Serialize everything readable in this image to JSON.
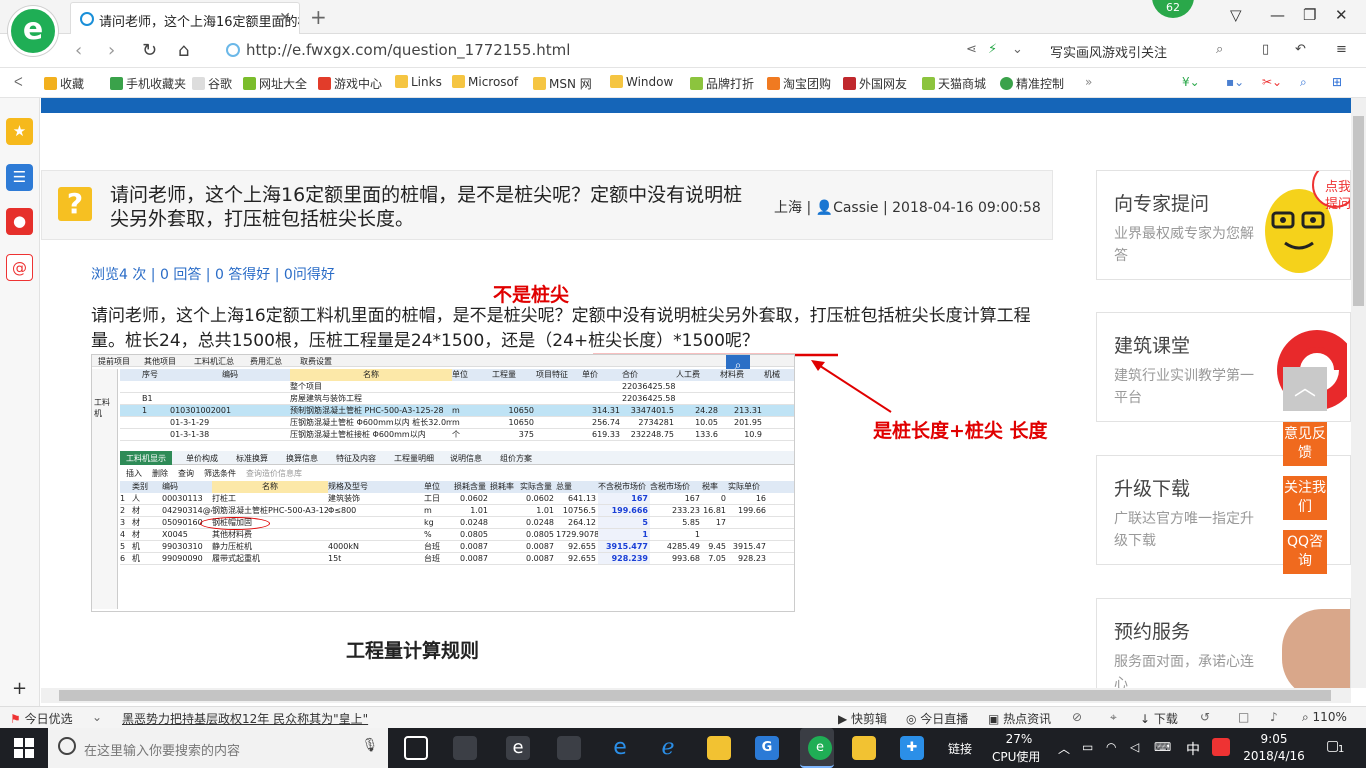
{
  "tab": {
    "title": "请问老师，这个上海16定额里面的桩"
  },
  "badge": "62",
  "address": {
    "url": "http://e.fwxgx.com/question_1772155.html",
    "search_hint": "写实画风游戏引关注"
  },
  "bookmarks": [
    "收藏",
    "手机收藏夹",
    "谷歌",
    "网址大全",
    "游戏中心",
    "Links",
    "Microsof",
    "MSN 网",
    "Window",
    "品牌打折",
    "淘宝团购",
    "外国网友",
    "天猫商城",
    "精准控制"
  ],
  "question": {
    "title": "请问老师，这个上海16定额里面的桩帽，是不是桩尖呢？定额中没有说明桩尖另外套取，打压桩包括桩尖长度。",
    "location": "上海",
    "author": "Cassie",
    "datetime": "2018-04-16 09:00:58",
    "stats": "浏览4 次 | 0 回答 | 0 答得好 | 0问得好",
    "body_text": "请问老师，这个上海16定额工料机里面的桩帽，是不是桩尖呢？定额中没有说明桩尖另外套取，打压桩包括桩尖长度计算工程量。桩长24，总共1500根，压桩工程量是24*1500，还是（24+桩尖长度）*1500呢？",
    "annotation_top": "不是桩尖",
    "annotation_right": "是桩长度+桩尖 长度",
    "section_heading": "工程量计算规则"
  },
  "screenshot": {
    "menu": [
      "提前项目",
      "其他项目",
      "工料机汇总",
      "费用汇总",
      "取费设置"
    ],
    "upper_headers": [
      "序号",
      "编码",
      "名称",
      "单位",
      "工程量",
      "项目特征",
      "单价",
      "合价",
      "人工费",
      "材料费",
      "机械"
    ],
    "upper_rows": [
      [
        "",
        "",
        "整个项目",
        "",
        "",
        "",
        "",
        "22036425.58",
        "",
        "",
        ""
      ],
      [
        "B1",
        "",
        "房屋建筑与装饰工程",
        "",
        "",
        "",
        "",
        "22036425.58",
        "",
        "",
        ""
      ],
      [
        "1",
        "010301002001",
        "预制钢筋混凝土管桩 PHC-500-A3-125-28",
        "m",
        "10650",
        "",
        "314.31",
        "3347401.5",
        "24.28",
        "213.31",
        ""
      ],
      [
        "",
        "01-3-1-29",
        "压钢筋混凝土管桩 Φ600mm以内 桩长32.0m以内",
        "m",
        "10650",
        "",
        "256.74",
        "2734281",
        "10.05",
        "201.95",
        ""
      ],
      [
        "",
        "01-3-1-38",
        "压钢筋混凝土管桩接桩 Φ600mm以内",
        "个",
        "375",
        "",
        "619.33",
        "232248.75",
        "133.6",
        "10.9",
        ""
      ]
    ],
    "tabs": [
      "工料机显示",
      "单价构成",
      "标准换算",
      "换算信息",
      "特征及内容",
      "工程量明细",
      "说明信息",
      "组价方案"
    ],
    "toolbar": [
      "插入",
      "删除",
      "查询",
      "筛选条件",
      "查询造价信息库"
    ],
    "lower_headers": [
      "",
      "类别",
      "编码",
      "名称",
      "规格及型号",
      "单位",
      "损耗含量",
      "损耗率",
      "实际含量",
      "总量",
      "不含税市场价",
      "含税市场价",
      "税率",
      "实际单价"
    ],
    "lower_rows": [
      [
        "1",
        "人",
        "00030113",
        "打桩工",
        "建筑装饰",
        "工日",
        "0.0602",
        "",
        "0.0602",
        "641.13",
        "167",
        "167",
        "0",
        "16"
      ],
      [
        "2",
        "材",
        "04290314@4",
        "钢筋混凝土管桩PHC-500-A3-125...",
        "Φ≤800",
        "m",
        "1.01",
        "",
        "1.01",
        "10756.5",
        "199.666",
        "233.23",
        "16.81",
        "199.66"
      ],
      [
        "3",
        "材",
        "05090160",
        "钢桩帽加固",
        "",
        "kg",
        "0.0248",
        "",
        "0.0248",
        "264.12",
        "5",
        "5.85",
        "17",
        ""
      ],
      [
        "4",
        "材",
        "X0045",
        "其他材料费",
        "",
        "%",
        "0.0805",
        "",
        "0.0805",
        "1729.9078",
        "1",
        "1",
        "",
        ""
      ],
      [
        "5",
        "机",
        "99030310",
        "静力压桩机",
        "4000kN",
        "台班",
        "0.0087",
        "",
        "0.0087",
        "92.655",
        "3915.477",
        "4285.49",
        "9.45",
        "3915.47"
      ],
      [
        "6",
        "机",
        "99090090",
        "履带式起重机",
        "15t",
        "台班",
        "0.0087",
        "",
        "0.0087",
        "92.655",
        "928.239",
        "993.68",
        "7.05",
        "928.23"
      ]
    ],
    "side_label": "工料机"
  },
  "right_cards": [
    {
      "title": "向专家提问",
      "desc": "业界最权威专家为您解答",
      "img_text": "点我提问"
    },
    {
      "title": "建筑课堂",
      "desc": "建筑行业实训教学第一平台"
    },
    {
      "title": "升级下载",
      "desc": "广联达官方唯一指定升级下载"
    },
    {
      "title": "预约服务",
      "desc": "服务面对面，承诺心连心"
    }
  ],
  "float_buttons": [
    "意见反馈",
    "关注我们",
    "QQ咨询"
  ],
  "status": {
    "left1": "今日优选",
    "headline": "黑恶势力把持基层政权12年 民众称其为\"皇上\"",
    "items": [
      "快剪辑",
      "今日直播",
      "热点资讯",
      "下载",
      "110%"
    ]
  },
  "taskbar": {
    "search_placeholder": "在这里输入你要搜索的内容",
    "link_label": "链接",
    "cpu": "27%",
    "cpu_label": "CPU使用",
    "time": "9:05",
    "date": "2018/4/16",
    "lang": "中",
    "notify": "1"
  },
  "colors": {
    "accent_blue": "#1565b8",
    "orange": "#f06a1e",
    "annotation_red": "#e00000",
    "logo_green": "#1fae55"
  }
}
